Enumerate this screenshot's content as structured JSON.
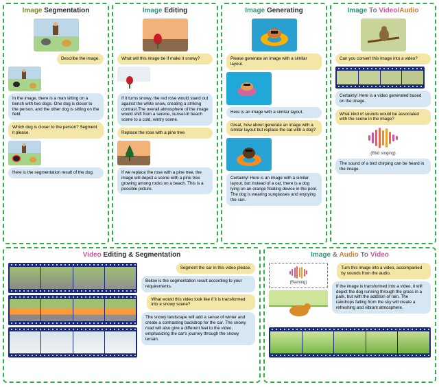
{
  "panels": {
    "seg": {
      "title_a": "Image",
      "title_b": "Segmentation",
      "q1": "Describe the image.",
      "a1": "In the image, there is a man sitting on a bench with two dogs. One dog is closer to the person, and the other dog is sitting on the field.",
      "q2": "Which dog is closer to the person? Segment it please.",
      "a2": "Here is the segmentation result of the dog."
    },
    "edit": {
      "title_a": "Image",
      "title_b": "Editing",
      "q1": "What will this image be if make it snowy?",
      "a1": "If it turns snowy, the red rose would stand out against the white snow, creating a striking contrast.The overall atmosphere of the image would shift from a serene, sunset-lit beach scene to a cold, wintry scene.",
      "q2": "Replace the rose with a pine tree.",
      "a2": "If we replace the rose with a pine tree, the image will depict a scene with a pine tree growing among rocks on a beach. This is a possible picture."
    },
    "gen": {
      "title_a": "Image",
      "title_b": "Generating",
      "q1": "Please generate an image with a similar layout.",
      "a1": "Here is an image with a similar layout.",
      "q2": "Great, how about generate an image with a similar layout but replace the cat with a dog?",
      "a2": "Certainly! Here is an image with a similar layout, but instead of a cat, there is a dog lying on an orange floating device in the pool. The dog is wearing sunglasses and enjoying the sun."
    },
    "tova": {
      "title_a": "Image",
      "title_b": "To",
      "title_c": "Video",
      "title_sep": "/",
      "title_d": "Audio",
      "q1": "Can you convert this image into a video?",
      "a1": "Certainly! Here is a video generated based on the image.",
      "q2": "What kind of sounds would be associated with the scene in the image?",
      "wave_caption": "(Bird singing)",
      "a2": "The sound of a bird chirping can be heard in the image."
    },
    "vedit": {
      "title_a": "Video",
      "title_b": "Editing & Segmentation",
      "q1": "Segment the car in this video please.",
      "a1": "Below is the segmentation result according to your requirements.",
      "q2": "What would this video look like if it is transformed into a snowy scene?",
      "a2": "The snowy landscape will add a sense of winter and create a contrasting backdrop for the car. The snowy road will also give a different feel to the video, emphasizing the car's journey through the snowy terrain."
    },
    "ia2v": {
      "title_a": "Image",
      "title_amp": "&",
      "title_b": "Audio",
      "title_to": "To",
      "title_c": "Video",
      "audio_caption": "(Raining)",
      "q1": "Turn this image into a video, accompanied by sounds from the audio.",
      "a1": "If the image is transformed into a video, it will depict the dog running through the grass in a park, but with the addition of rain. The raindrops falling from the sky will create a refreshing and vibrant atmosphere."
    }
  }
}
